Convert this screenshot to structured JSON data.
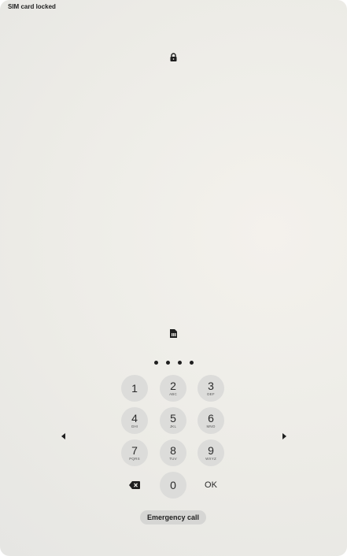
{
  "status_bar": {
    "carrier_text": "SIM card locked"
  },
  "icons": {
    "top": "lock-icon",
    "sim": "sim-card-icon",
    "backspace": "backspace-icon",
    "left": "arrow-left-icon",
    "right": "arrow-right-icon"
  },
  "pin_entry": {
    "digits_entered": 4
  },
  "keypad": {
    "keys": [
      {
        "num": "1",
        "letters": ""
      },
      {
        "num": "2",
        "letters": "ABC"
      },
      {
        "num": "3",
        "letters": "DEF"
      },
      {
        "num": "4",
        "letters": "GHI"
      },
      {
        "num": "5",
        "letters": "JKL"
      },
      {
        "num": "6",
        "letters": "MNO"
      },
      {
        "num": "7",
        "letters": "PQRS"
      },
      {
        "num": "8",
        "letters": "TUV"
      },
      {
        "num": "9",
        "letters": "WXYZ"
      },
      {
        "num": "0",
        "letters": ""
      }
    ],
    "ok_label": "OK"
  },
  "emergency_label": "Emergency call",
  "colors": {
    "key_background": "#dcdcda",
    "text": "#1f1f1f"
  }
}
